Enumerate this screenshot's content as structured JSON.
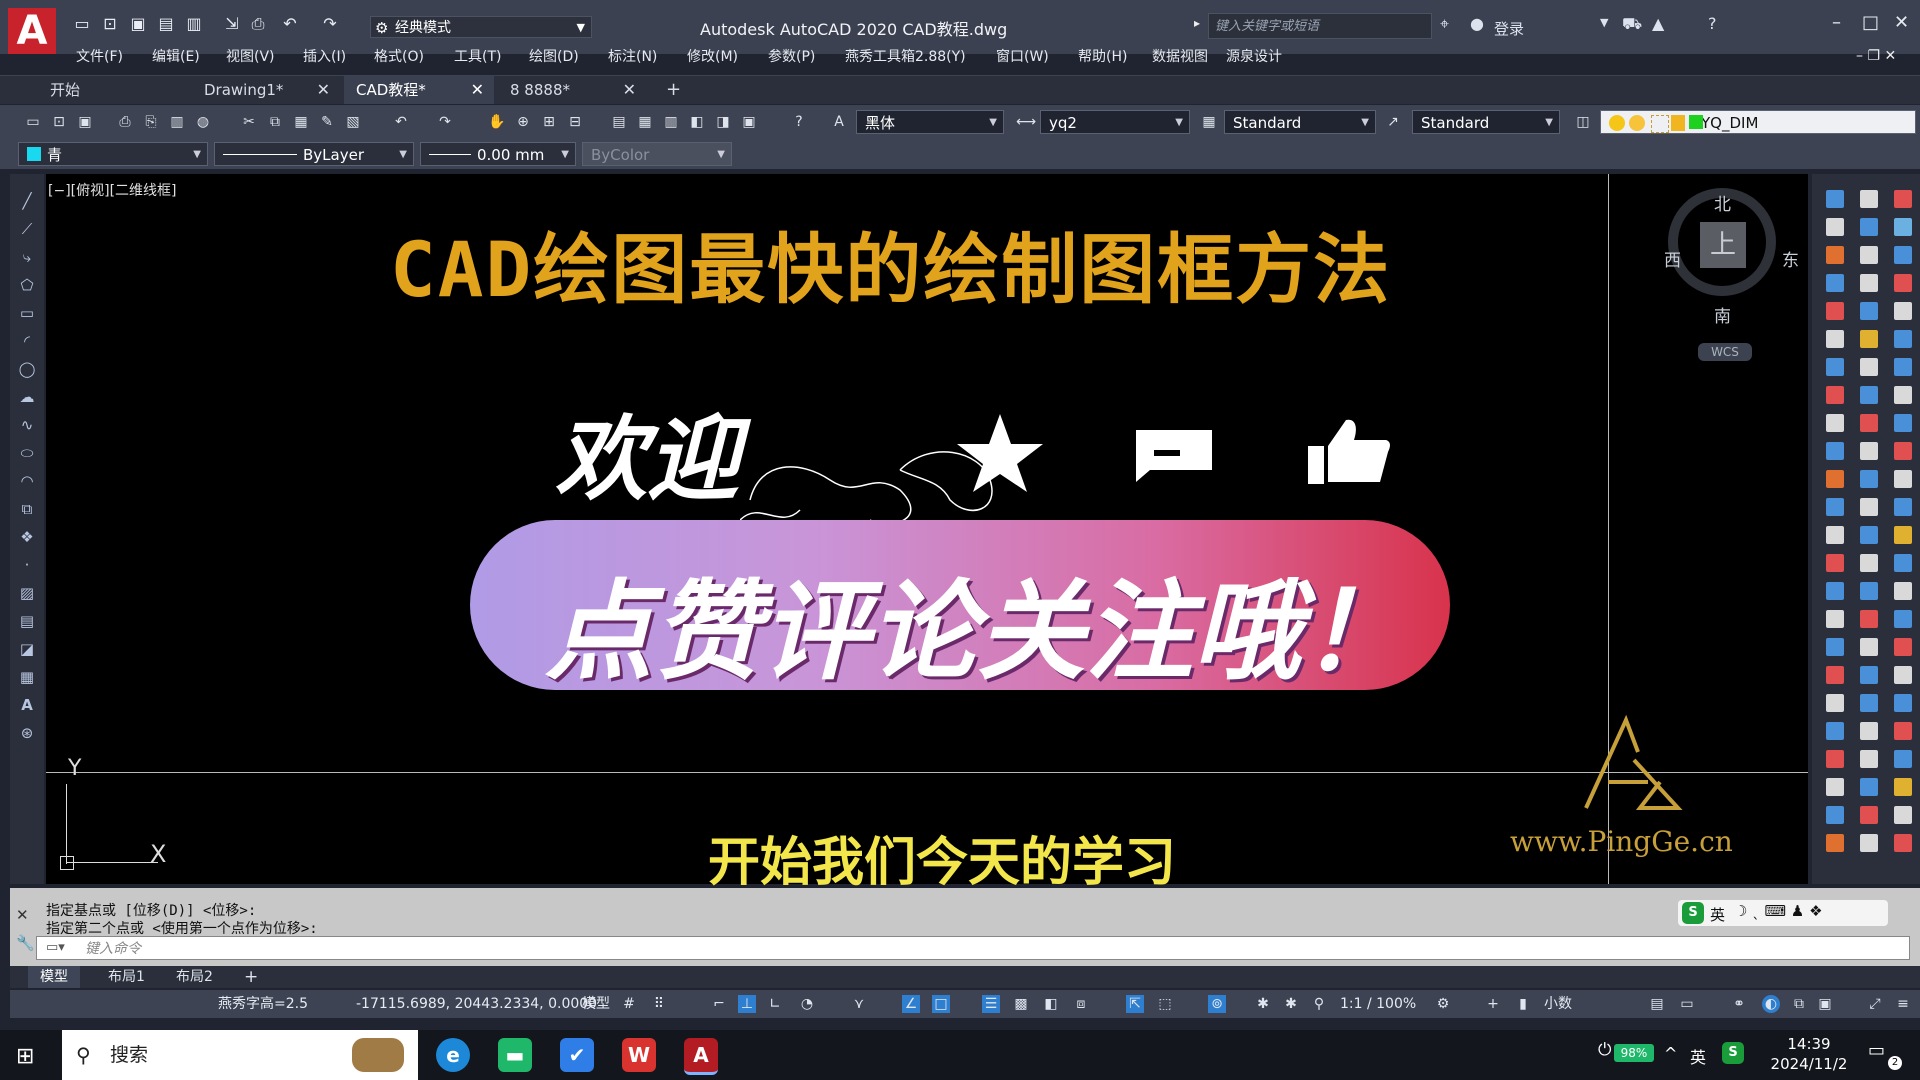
{
  "titlebar": {
    "app_logo": "A",
    "workspace": "经典模式",
    "title": "Autodesk AutoCAD 2020    CAD教程.dwg",
    "search_placeholder": "键入关键字或短语",
    "login": "登录"
  },
  "menu": [
    "文件(F)",
    "编辑(E)",
    "视图(V)",
    "插入(I)",
    "格式(O)",
    "工具(T)",
    "绘图(D)",
    "标注(N)",
    "修改(M)",
    "参数(P)",
    "燕秀工具箱2.88(Y)",
    "窗口(W)",
    "帮助(H)",
    "数据视图",
    "源泉设计"
  ],
  "tabs": [
    {
      "label": "开始"
    },
    {
      "label": "Drawing1*"
    },
    {
      "label": "CAD教程*"
    },
    {
      "label": "8 8888*"
    }
  ],
  "toolbar": {
    "font": "黑体",
    "text_style": "yq2",
    "dim_style": "Standard",
    "table_style": "Standard",
    "layer": "YQ_DIM",
    "color": "青",
    "linetype": "ByLayer",
    "lineweight": "0.00 mm",
    "plotstyle": "ByColor"
  },
  "canvas": {
    "viewport_label": "[−][俯视][二维线框]",
    "heading": "CAD绘图最快的绘制图框方法",
    "welcome": "欢迎",
    "banner": "点赞评论关注哦！",
    "subtitle": "开始我们今天的学习",
    "watermark": "www.PingGe.cn",
    "compass": {
      "north": "北",
      "south": "南",
      "east": "东",
      "west": "西",
      "center": "上",
      "wcs": "WCS"
    },
    "ucs_x": "X",
    "ucs_y": "Y"
  },
  "command": {
    "history": [
      "指定基点或 [位移(D)] <位移>:",
      "指定第二个点或 <使用第一个点作为位移>:"
    ],
    "placeholder": "键入命令",
    "ime": "英"
  },
  "layout_tabs": [
    "模型",
    "布局1",
    "布局2"
  ],
  "statusbar": {
    "text_height": "燕秀字高=2.5",
    "coords": "-17115.6989, 20443.2334, 0.0000",
    "space": "模型",
    "scale": "1:1 / 100%",
    "units": "小数"
  },
  "taskbar": {
    "search": "搜索",
    "battery": "98%",
    "ime": "英",
    "time": "14:39",
    "date": "2024/11/2",
    "notifications": "2"
  }
}
